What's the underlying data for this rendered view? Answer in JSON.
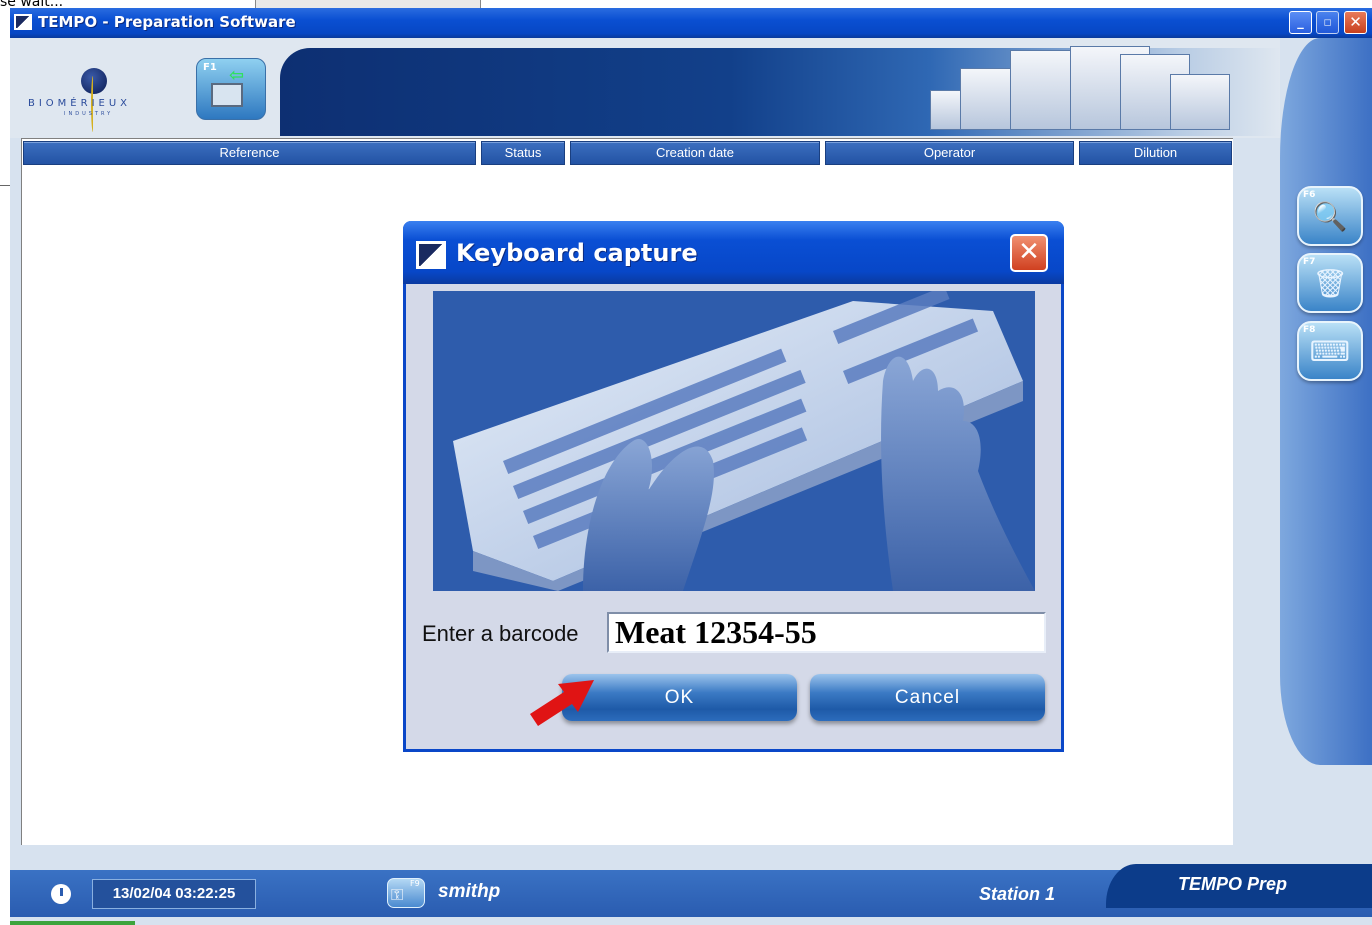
{
  "background": {
    "wait_text": "se wait..."
  },
  "window": {
    "title": "TEMPO - Preparation Software",
    "controls": {
      "minimize": "_",
      "maximize": "▫",
      "close": "✕"
    }
  },
  "header": {
    "logo_text": "BIOMÉRIEUX",
    "logo_subtext": "INDUSTRY",
    "f1_label": "F1",
    "f1_icon": "exit-arrow-icon"
  },
  "table": {
    "columns": [
      "Reference",
      "Status",
      "Creation date",
      "Operator",
      "Dilution"
    ],
    "rows": []
  },
  "side_buttons": [
    {
      "key": "F6",
      "icon": "magnifier-icon"
    },
    {
      "key": "F7",
      "icon": "trash-icon"
    },
    {
      "key": "F8",
      "icon": "keyboard-icon"
    }
  ],
  "dialog": {
    "title": "Keyboard capture",
    "close_glyph": "✕",
    "image": "keyboard-hands-illustration",
    "barcode_label": "Enter a barcode",
    "barcode_value": "Meat 12354-55",
    "ok_label": "OK",
    "cancel_label": "Cancel"
  },
  "statusbar": {
    "datetime": "13/02/04 03:22:25",
    "key_label": "F9",
    "username": "smithp",
    "station": "Station 1",
    "app_name": "TEMPO Prep"
  },
  "colors": {
    "titlebar": "#0a4fd2",
    "table_header": "#2f62b4",
    "statusbar": "#2a5cb0",
    "arrow": "#e01010"
  }
}
